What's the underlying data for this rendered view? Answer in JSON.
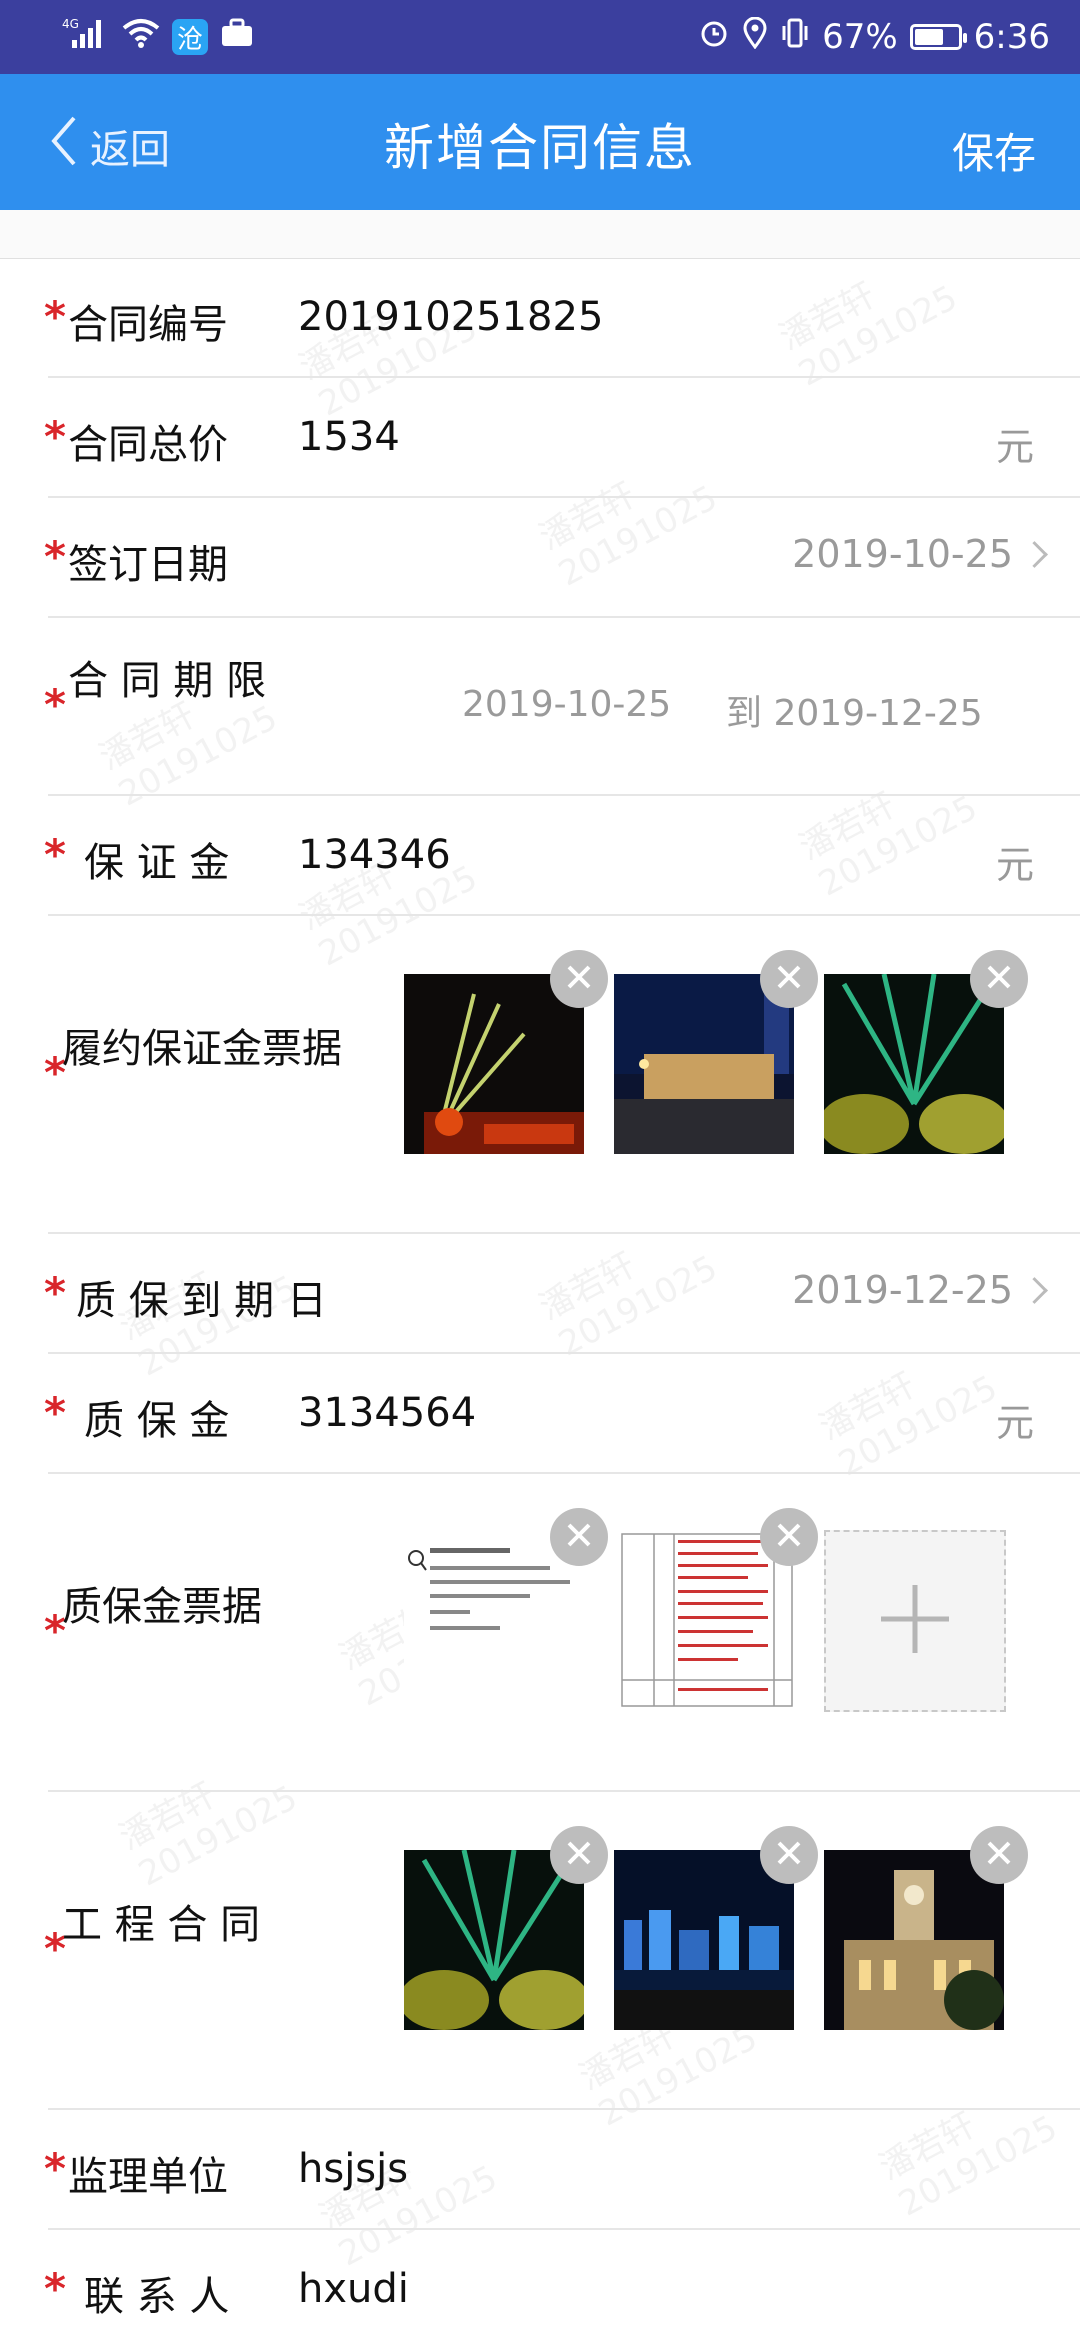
{
  "status_bar": {
    "network": "4G",
    "app_badge": "沧",
    "battery": "67%",
    "battery_level": 0.67,
    "time": "6:36",
    "icons": [
      "signal-icon",
      "wifi-icon",
      "app-badge-icon",
      "briefcase-icon",
      "alarm-icon",
      "location-icon",
      "vibrate-icon",
      "battery-icon"
    ]
  },
  "nav": {
    "back_label": "返回",
    "title": "新增合同信息",
    "save_label": "保存"
  },
  "form": {
    "contract_no": {
      "label": "合同编号",
      "value": "201910251825"
    },
    "total_price": {
      "label": "合同总价",
      "value": "1534",
      "unit": "元"
    },
    "sign_date": {
      "label": "签订日期",
      "value": "2019-10-25"
    },
    "term": {
      "label": "合 同 期 限",
      "start": "2019-10-25",
      "end": "到 2019-12-25"
    },
    "deposit": {
      "label": "保 证 金",
      "value": "134346",
      "unit": "元"
    },
    "deposit_receipts": {
      "label": "履约保证金票据",
      "images": [
        "night-laser-photo",
        "city-night-photo",
        "laser-trees-photo"
      ]
    },
    "warranty_due": {
      "label": "质 保 到 期 日",
      "value": "2019-12-25"
    },
    "warranty_money": {
      "label": "质 保 金",
      "value": "3134564",
      "unit": "元"
    },
    "warranty_receipts": {
      "label": "质保金票据",
      "images": [
        "document-scan-photo",
        "table-scan-photo"
      ],
      "add_icon": "plus-icon"
    },
    "project_contract": {
      "label": "工 程 合 同",
      "images": [
        "laser-trees-photo",
        "skyline-night-photo",
        "clock-tower-photo"
      ]
    },
    "supervisor": {
      "label": "监理单位",
      "value": "hsjsjs"
    },
    "contact": {
      "label": "联 系 人",
      "value": "hxudi"
    }
  },
  "watermark": {
    "line1": "潘若轩",
    "line2": "20191025"
  },
  "colors": {
    "status_bar": "#3b3f9e",
    "nav_bar": "#2f8fee",
    "required_star": "#d9252a"
  }
}
